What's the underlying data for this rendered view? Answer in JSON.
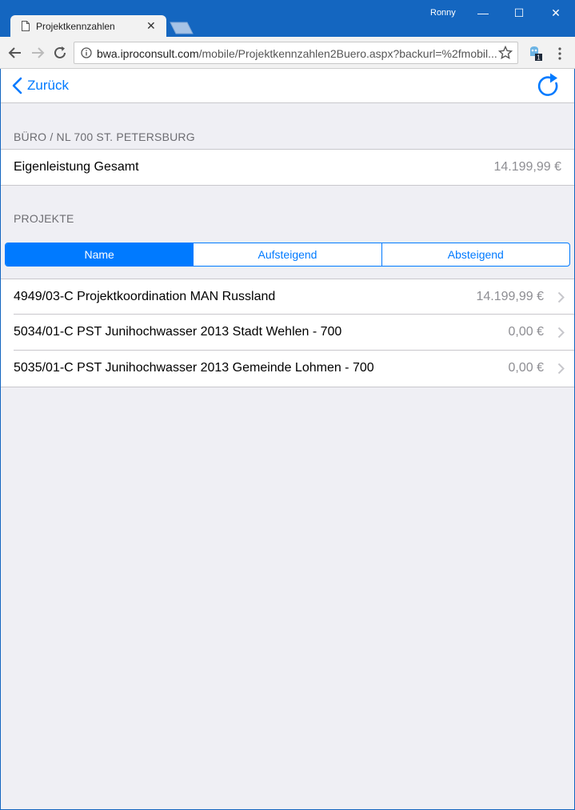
{
  "browser": {
    "tab_title": "Projektkennzahlen",
    "user_name": "Ronny",
    "url_host": "bwa.iproconsult.com",
    "url_path": "/mobile/Projektkennzahlen2Buero.aspx?backurl=%2fmobil...",
    "extension_badge": "1",
    "close_tab_glyph": "✕",
    "minimize_glyph": "—",
    "maximize_glyph": "☐",
    "close_glyph": "✕"
  },
  "nav": {
    "back_label": "Zurück"
  },
  "buero": {
    "header": "BÜRO / NL 700 ST. PETERSBURG",
    "row_label": "Eigenleistung Gesamt",
    "row_value": "14.199,99 €"
  },
  "projekte": {
    "header": "PROJEKTE",
    "sort_options": [
      "Name",
      "Aufsteigend",
      "Absteigend"
    ],
    "sort_selected": "Name",
    "items": [
      {
        "label": "4949/03-C Projektkoordination MAN Russland",
        "value": "14.199,99 €"
      },
      {
        "label": "5034/01-C PST Junihochwasser 2013 Stadt Wehlen - 700",
        "value": "0,00 €"
      },
      {
        "label": "5035/01-C PST Junihochwasser 2013 Gemeinde Lohmen - 700",
        "value": "0,00 €"
      }
    ]
  },
  "colors": {
    "accent": "#007aff",
    "chrome_blue": "#1466c0",
    "background": "#efeff4",
    "secondary_text": "#8e8e93"
  },
  "icons": [
    "page-icon",
    "close-icon",
    "back-arrow-icon",
    "forward-arrow-icon",
    "reload-icon",
    "info-icon",
    "star-icon",
    "extension-icon",
    "menu-icon",
    "chevron-left-icon",
    "refresh-icon",
    "chevron-right-icon"
  ]
}
